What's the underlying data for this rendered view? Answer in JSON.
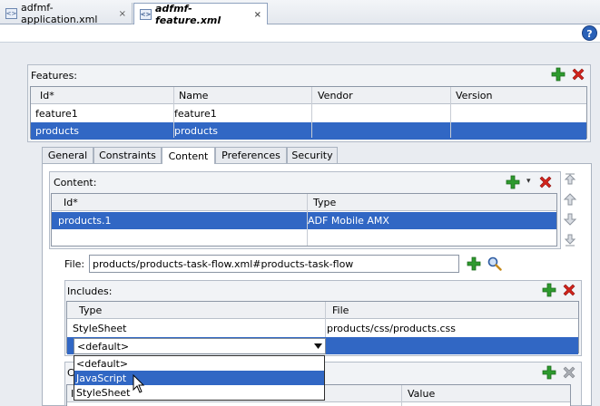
{
  "editor_tabs": [
    {
      "label": "adfmf-application.xml",
      "close": "×"
    },
    {
      "label": "adfmf-feature.xml",
      "close": "×"
    }
  ],
  "help_label": "?",
  "features": {
    "title": "Features:",
    "columns": [
      "Id*",
      "Name",
      "Vendor",
      "Version"
    ],
    "rows": [
      {
        "id": "feature1",
        "name": "feature1",
        "vendor": "",
        "version": ""
      },
      {
        "id": "products",
        "name": "products",
        "vendor": "",
        "version": ""
      }
    ]
  },
  "detail_tabs": [
    "General",
    "Constraints",
    "Content",
    "Preferences",
    "Security"
  ],
  "content": {
    "title": "Content:",
    "columns": [
      "Id*",
      "Type"
    ],
    "rows": [
      {
        "id": "products.1",
        "type": "ADF Mobile AMX"
      }
    ],
    "dropdown_arrow": "▾"
  },
  "file": {
    "label": "File:",
    "value": "products/products-task-flow.xml#products-task-flow"
  },
  "includes": {
    "title": "Includes:",
    "columns": [
      "Type",
      "File"
    ],
    "rows": [
      {
        "type": "StyleSheet",
        "file": "products/css/products.css"
      }
    ],
    "editing_value": "<default>",
    "options": [
      "<default>",
      "JavaScript",
      "StyleSheet"
    ],
    "highlighted_option": "JavaScript"
  },
  "lower_panel": {
    "title_partial": "C",
    "col_partial": "I",
    "col_value": "Value"
  },
  "colors": {
    "selection": "#3167c4",
    "add_green": "#2e9a2e",
    "delete_red": "#d2231b"
  }
}
